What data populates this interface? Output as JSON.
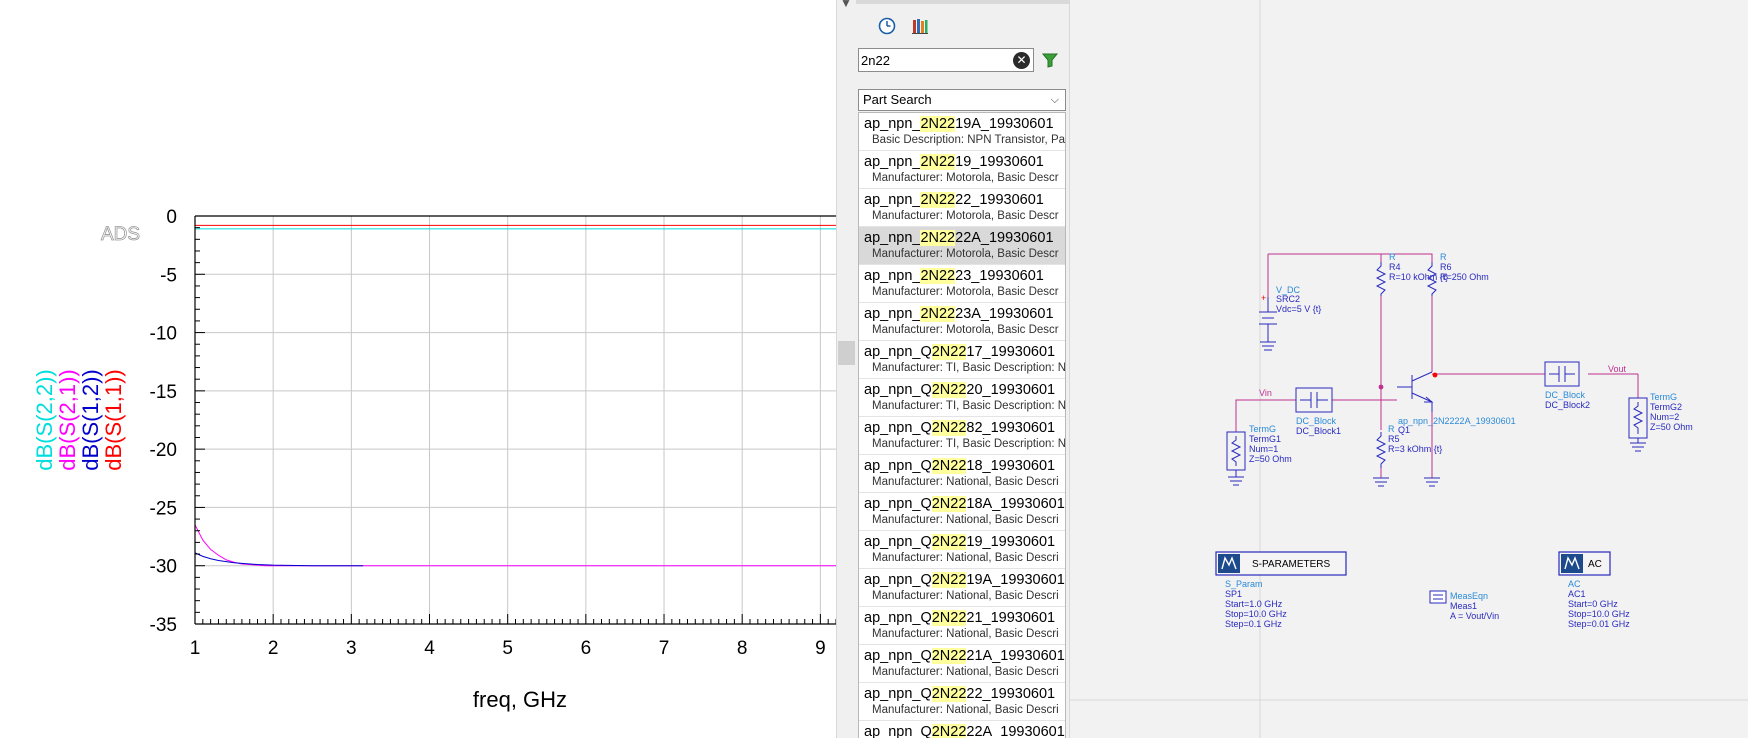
{
  "plot": {
    "watermark": "ADS",
    "chart_data": {
      "type": "line",
      "xlabel": "freq, GHz",
      "ylabel": "",
      "xlim": [
        1,
        9.2
      ],
      "ylim": [
        -35,
        0
      ],
      "xticks": [
        "1",
        "2",
        "3",
        "4",
        "5",
        "6",
        "7",
        "8",
        "9"
      ],
      "yticks": [
        "0",
        "-5",
        "-10",
        "-15",
        "-20",
        "-25",
        "-30",
        "-35"
      ],
      "grid": true,
      "legend": [
        "dB(S(2,2))",
        "dB(S(2,1))",
        "dB(S(1,2))",
        "dB(S(1,1))"
      ],
      "legend_colors": [
        "#00dddd",
        "#ff00ff",
        "#0000cc",
        "#ff0000"
      ],
      "series": [
        {
          "name": "dB(S(1,1))",
          "color": "#ff0000",
          "x": [
            1,
            9.2
          ],
          "y": [
            -0.8,
            -0.8
          ]
        },
        {
          "name": "dB(S(2,2))",
          "color": "#00dddd",
          "x": [
            1,
            9.2
          ],
          "y": [
            -1.1,
            -1.1
          ]
        },
        {
          "name": "dB(S(2,1))",
          "color": "#ff00ff",
          "x": [
            1,
            1.1,
            1.2,
            1.3,
            1.4,
            1.5,
            1.6,
            1.7,
            1.8,
            1.9,
            2.0,
            2.5,
            3,
            9.2
          ],
          "y": [
            -26.5,
            -27.8,
            -28.6,
            -29.1,
            -29.5,
            -29.7,
            -29.85,
            -29.9,
            -29.95,
            -30,
            -30,
            -30,
            -30,
            -30
          ]
        },
        {
          "name": "dB(S(1,2))",
          "color": "#0000cc",
          "x": [
            1,
            1.1,
            1.2,
            1.3,
            1.4,
            1.5,
            1.6,
            1.8,
            2.0,
            2.5,
            3.15
          ],
          "y": [
            -28.9,
            -29.2,
            -29.4,
            -29.55,
            -29.65,
            -29.75,
            -29.8,
            -29.9,
            -29.95,
            -30,
            -30
          ]
        }
      ]
    }
  },
  "library": {
    "search_value": "2n22",
    "search_query": "2N22",
    "mode": "Part Search",
    "items": [
      {
        "pre": "ap_npn_",
        "hl": "2N22",
        "post": "19A_19930601",
        "desc": "Basic Description: NPN Transistor, Pa"
      },
      {
        "pre": "ap_npn_",
        "hl": "2N22",
        "post": "19_19930601",
        "desc": "Manufacturer: Motorola, Basic Descr"
      },
      {
        "pre": "ap_npn_",
        "hl": "2N22",
        "post": "22_19930601",
        "desc": "Manufacturer: Motorola, Basic Descr"
      },
      {
        "pre": "ap_npn_",
        "hl": "2N22",
        "post": "22A_19930601",
        "desc": "Manufacturer: Motorola, Basic Descr",
        "selected": true
      },
      {
        "pre": "ap_npn_",
        "hl": "2N22",
        "post": "23_19930601",
        "desc": "Manufacturer: Motorola, Basic Descr"
      },
      {
        "pre": "ap_npn_",
        "hl": "2N22",
        "post": "23A_19930601",
        "desc": "Manufacturer: Motorola, Basic Descr"
      },
      {
        "pre": "ap_npn_Q",
        "hl": "2N22",
        "post": "17_19930601",
        "desc": "Manufacturer: TI, Basic Description: N"
      },
      {
        "pre": "ap_npn_Q",
        "hl": "2N22",
        "post": "20_19930601",
        "desc": "Manufacturer: TI, Basic Description: N"
      },
      {
        "pre": "ap_npn_Q",
        "hl": "2N22",
        "post": "82_19930601",
        "desc": "Manufacturer: TI, Basic Description: N"
      },
      {
        "pre": "ap_npn_Q",
        "hl": "2N22",
        "post": "18_19930601",
        "desc": "Manufacturer: National, Basic Descri"
      },
      {
        "pre": "ap_npn_Q",
        "hl": "2N22",
        "post": "18A_19930601",
        "desc": "Manufacturer: National, Basic Descri"
      },
      {
        "pre": "ap_npn_Q",
        "hl": "2N22",
        "post": "19_19930601",
        "desc": "Manufacturer: National, Basic Descri"
      },
      {
        "pre": "ap_npn_Q",
        "hl": "2N22",
        "post": "19A_19930601",
        "desc": "Manufacturer: National, Basic Descri"
      },
      {
        "pre": "ap_npn_Q",
        "hl": "2N22",
        "post": "21_19930601",
        "desc": "Manufacturer: National, Basic Descri"
      },
      {
        "pre": "ap_npn_Q",
        "hl": "2N22",
        "post": "21A_19930601",
        "desc": "Manufacturer: National, Basic Descri"
      },
      {
        "pre": "ap_npn_Q",
        "hl": "2N22",
        "post": "22_19930601",
        "desc": "Manufacturer: National, Basic Descri"
      },
      {
        "pre": "ap_npn_Q",
        "hl": "2N22",
        "post": "22A_19930601",
        "desc": ""
      }
    ]
  },
  "schematic": {
    "vdc": {
      "l1": "V_DC",
      "l2": "SRC2",
      "l3": "Vdc=5 V {t}"
    },
    "r4": {
      "l1": "R",
      "l2": "R4",
      "l3": "R=10 kOhm {t}"
    },
    "r6": {
      "l1": "R",
      "l2": "R6",
      "l3": "R=250 Ohm"
    },
    "r5": {
      "l1": "R",
      "l2": "R5",
      "l3": "R=3 kOhm {t}"
    },
    "q1": {
      "l1": "Q1",
      "l2": "ap_npn_2N2222A_19930601"
    },
    "dcb1": {
      "l1": "DC_Block",
      "l2": "DC_Block1"
    },
    "dcb2": {
      "l1": "DC_Block",
      "l2": "DC_Block2"
    },
    "term1": {
      "l1": "TermG",
      "l2": "TermG1",
      "l3": "Num=1",
      "l4": "Z=50 Ohm"
    },
    "term2": {
      "l1": "TermG",
      "l2": "TermG2",
      "l3": "Num=2",
      "l4": "Z=50 Ohm"
    },
    "vin": "Vin",
    "vout": "Vout",
    "sparam": {
      "title": "S-PARAMETERS",
      "l1": "S_Param",
      "l2": "SP1",
      "l3": "Start=1.0 GHz",
      "l4": "Stop=10.0 GHz",
      "l5": "Step=0.1 GHz"
    },
    "meas": {
      "l1": "MeasEqn",
      "l2": "Meas1",
      "l3": "A = Vout/Vin"
    },
    "ac": {
      "title": "AC",
      "l1": "AC",
      "l2": "AC1",
      "l3": "Start=0 GHz",
      "l4": "Stop=10.0 GHz",
      "l5": "Step=0.01 GHz"
    }
  }
}
